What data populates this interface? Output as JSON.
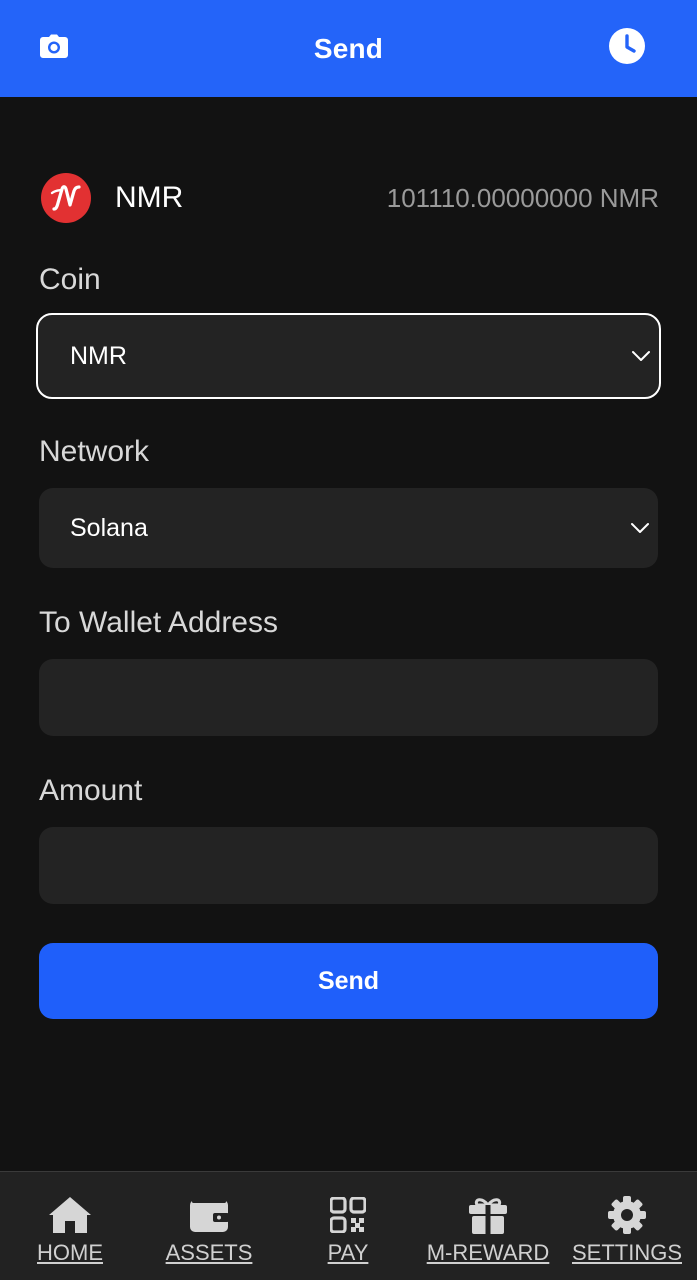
{
  "header": {
    "title": "Send",
    "left_icon": "camera-icon",
    "right_icon": "clock-icon"
  },
  "coin_summary": {
    "logo_letter": "N",
    "name": "NMR",
    "balance": "101110.00000000 NMR"
  },
  "form": {
    "coin": {
      "label": "Coin",
      "value": "NMR"
    },
    "network": {
      "label": "Network",
      "value": "Solana"
    },
    "address": {
      "label": "To Wallet Address",
      "value": "",
      "placeholder": ""
    },
    "amount": {
      "label": "Amount",
      "value": "",
      "placeholder": ""
    },
    "submit_label": "Send"
  },
  "bottom_nav": [
    {
      "label": "HOME",
      "icon": "home-icon"
    },
    {
      "label": "ASSETS",
      "icon": "wallet-icon"
    },
    {
      "label": "PAY",
      "icon": "qr-code-icon"
    },
    {
      "label": "M-REWARD",
      "icon": "gift-icon"
    },
    {
      "label": "SETTINGS",
      "icon": "gear-icon"
    }
  ],
  "colors": {
    "header": "#2464f9",
    "background": "#121212",
    "field": "#232323",
    "button": "#1f5ffa",
    "coin_logo": "#e23132",
    "nav": "#222222"
  }
}
